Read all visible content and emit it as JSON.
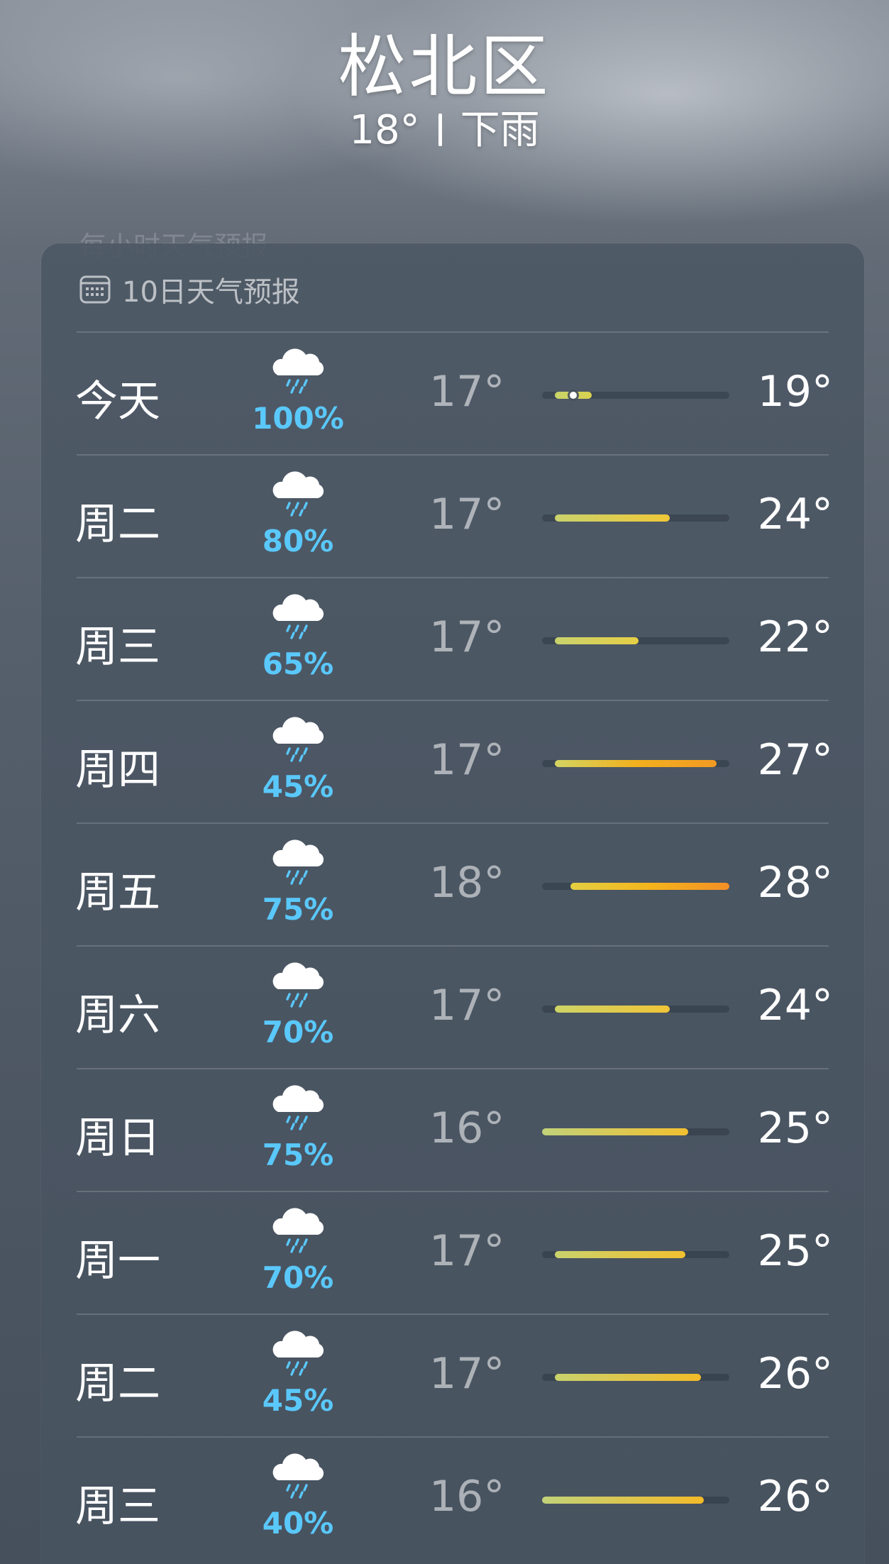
{
  "location": {
    "city": "松北区",
    "current_temp": "18°",
    "condition": "下雨"
  },
  "hourly_hint": "每小时天气预报",
  "forecast": {
    "title": "10日天气预报",
    "icon": "calendar-icon",
    "range_min": 16,
    "range_max": 28,
    "days": [
      {
        "day": "今天",
        "icon": "rain-cloud-icon",
        "precip": "100%",
        "low_label": "17°",
        "high_label": "19°",
        "low": 17,
        "high": 19,
        "current": 18,
        "colors": [
          "#c9d46a",
          "#d9d24f"
        ]
      },
      {
        "day": "周二",
        "icon": "rain-cloud-icon",
        "precip": "80%",
        "low_label": "17°",
        "high_label": "24°",
        "low": 17,
        "high": 24,
        "colors": [
          "#c9d26d",
          "#f0c838"
        ]
      },
      {
        "day": "周三",
        "icon": "rain-cloud-icon",
        "precip": "65%",
        "low_label": "17°",
        "high_label": "22°",
        "low": 17,
        "high": 22,
        "colors": [
          "#c9d26d",
          "#e6cf45"
        ]
      },
      {
        "day": "周四",
        "icon": "rain-cloud-icon",
        "precip": "45%",
        "low_label": "17°",
        "high_label": "27°",
        "low": 17,
        "high": 27,
        "colors": [
          "#d2d462",
          "#f2b01e",
          "#f29a22"
        ]
      },
      {
        "day": "周五",
        "icon": "rain-cloud-icon",
        "precip": "75%",
        "low_label": "18°",
        "high_label": "28°",
        "low": 18,
        "high": 28,
        "colors": [
          "#e4cf42",
          "#f5b41c",
          "#f48f25"
        ]
      },
      {
        "day": "周六",
        "icon": "rain-cloud-icon",
        "precip": "70%",
        "low_label": "17°",
        "high_label": "24°",
        "low": 17,
        "high": 24,
        "colors": [
          "#cdd466",
          "#f1c437"
        ]
      },
      {
        "day": "周日",
        "icon": "rain-cloud-icon",
        "precip": "75%",
        "low_label": "16°",
        "high_label": "25°",
        "low": 16,
        "high": 25,
        "colors": [
          "#c2d27a",
          "#f2c030"
        ]
      },
      {
        "day": "周一",
        "icon": "rain-cloud-icon",
        "precip": "70%",
        "low_label": "17°",
        "high_label": "25°",
        "low": 17,
        "high": 25,
        "colors": [
          "#c9d26d",
          "#f2c030"
        ]
      },
      {
        "day": "周二",
        "icon": "rain-cloud-icon",
        "precip": "45%",
        "low_label": "17°",
        "high_label": "26°",
        "low": 17,
        "high": 26,
        "colors": [
          "#c9d26d",
          "#f3bb28"
        ]
      },
      {
        "day": "周三",
        "icon": "rain-cloud-icon",
        "precip": "40%",
        "low_label": "16°",
        "high_label": "26°",
        "low": 16,
        "high": 26,
        "colors": [
          "#c2d27a",
          "#f3bb28"
        ]
      }
    ]
  }
}
